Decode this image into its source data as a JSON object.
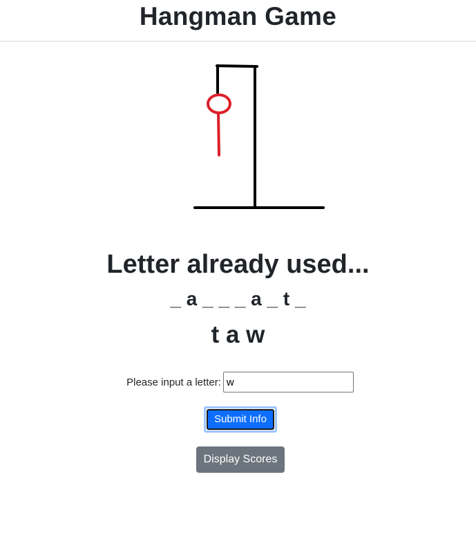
{
  "header": {
    "title": "Hangman Game"
  },
  "game": {
    "status_message": "Letter already used...",
    "masked_word": "_ a _ _ _ a _ t _",
    "guessed_letters": "t a w"
  },
  "form": {
    "label": "Please input a letter:",
    "input_value": "w",
    "submit_label": "Submit Info"
  },
  "scores_button_label": "Display Scores",
  "colors": {
    "gallows": "#000000",
    "hangman": "#dc1f2a",
    "primary_button": "#0d6efd",
    "secondary_button": "#6c757d"
  }
}
